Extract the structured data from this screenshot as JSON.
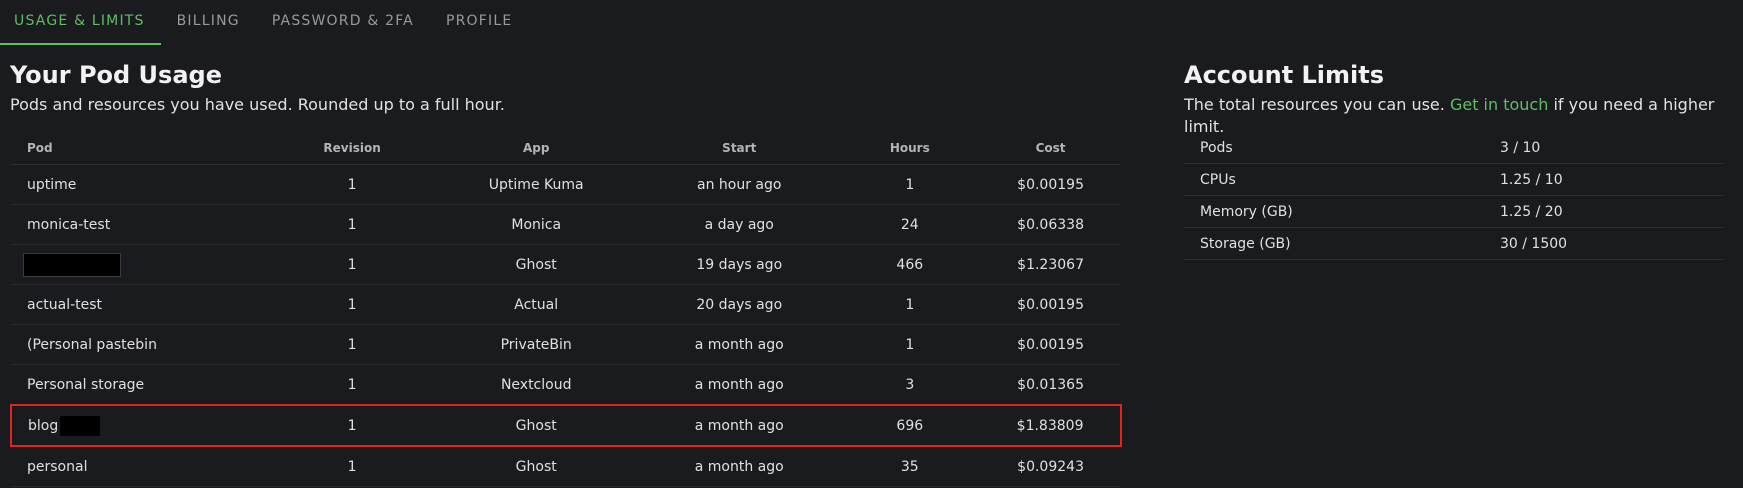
{
  "tabs": [
    {
      "label": "USAGE & LIMITS",
      "active": true
    },
    {
      "label": "BILLING",
      "active": false
    },
    {
      "label": "PASSWORD & 2FA",
      "active": false
    },
    {
      "label": "PROFILE",
      "active": false
    }
  ],
  "usage": {
    "title": "Your Pod Usage",
    "subtitle": "Pods and resources you have used. Rounded up to a full hour.",
    "columns": [
      "Pod",
      "Revision",
      "App",
      "Start",
      "Hours",
      "Cost"
    ],
    "rows": [
      {
        "pod": "uptime",
        "revision": "1",
        "app": "Uptime Kuma",
        "start": "an hour ago",
        "hours": "1",
        "cost": "$0.00195"
      },
      {
        "pod": "monica-test",
        "revision": "1",
        "app": "Monica",
        "start": "a day ago",
        "hours": "24",
        "cost": "$0.06338"
      },
      {
        "pod": "",
        "revision": "1",
        "app": "Ghost",
        "start": "19 days ago",
        "hours": "466",
        "cost": "$1.23067"
      },
      {
        "pod": "actual-test",
        "revision": "1",
        "app": "Actual",
        "start": "20 days ago",
        "hours": "1",
        "cost": "$0.00195"
      },
      {
        "pod": "(Personal pastebin",
        "revision": "1",
        "app": "PrivateBin",
        "start": "a month ago",
        "hours": "1",
        "cost": "$0.00195"
      },
      {
        "pod": "Personal storage",
        "revision": "1",
        "app": "Nextcloud",
        "start": "a month ago",
        "hours": "3",
        "cost": "$0.01365"
      },
      {
        "pod": "blog",
        "revision": "1",
        "app": "Ghost",
        "start": "a month ago",
        "hours": "696",
        "cost": "$1.83809"
      },
      {
        "pod": "personal",
        "revision": "1",
        "app": "Ghost",
        "start": "a month ago",
        "hours": "35",
        "cost": "$0.09243"
      }
    ]
  },
  "limits": {
    "title": "Account Limits",
    "subtitle_before": "The total resources you can use. ",
    "subtitle_link": "Get in touch",
    "subtitle_after": " if you need a higher limit.",
    "rows": [
      {
        "label": "Pods",
        "value": "3 / 10"
      },
      {
        "label": "CPUs",
        "value": "1.25 / 10"
      },
      {
        "label": "Memory (GB)",
        "value": "1.25 / 20"
      },
      {
        "label": "Storage (GB)",
        "value": "30 / 1500"
      }
    ]
  },
  "colors": {
    "background": "#1a1b1e",
    "accent": "#5fbf5f",
    "highlight": "#e02424"
  }
}
